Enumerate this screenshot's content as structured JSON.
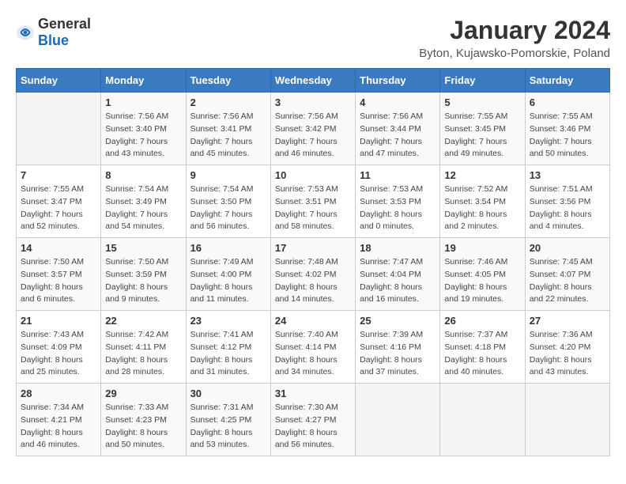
{
  "logo": {
    "general": "General",
    "blue": "Blue"
  },
  "title": "January 2024",
  "location": "Byton, Kujawsko-Pomorskie, Poland",
  "headers": [
    "Sunday",
    "Monday",
    "Tuesday",
    "Wednesday",
    "Thursday",
    "Friday",
    "Saturday"
  ],
  "weeks": [
    [
      {
        "day": "",
        "sunrise": "",
        "sunset": "",
        "daylight": ""
      },
      {
        "day": "1",
        "sunrise": "Sunrise: 7:56 AM",
        "sunset": "Sunset: 3:40 PM",
        "daylight": "Daylight: 7 hours and 43 minutes."
      },
      {
        "day": "2",
        "sunrise": "Sunrise: 7:56 AM",
        "sunset": "Sunset: 3:41 PM",
        "daylight": "Daylight: 7 hours and 45 minutes."
      },
      {
        "day": "3",
        "sunrise": "Sunrise: 7:56 AM",
        "sunset": "Sunset: 3:42 PM",
        "daylight": "Daylight: 7 hours and 46 minutes."
      },
      {
        "day": "4",
        "sunrise": "Sunrise: 7:56 AM",
        "sunset": "Sunset: 3:44 PM",
        "daylight": "Daylight: 7 hours and 47 minutes."
      },
      {
        "day": "5",
        "sunrise": "Sunrise: 7:55 AM",
        "sunset": "Sunset: 3:45 PM",
        "daylight": "Daylight: 7 hours and 49 minutes."
      },
      {
        "day": "6",
        "sunrise": "Sunrise: 7:55 AM",
        "sunset": "Sunset: 3:46 PM",
        "daylight": "Daylight: 7 hours and 50 minutes."
      }
    ],
    [
      {
        "day": "7",
        "sunrise": "Sunrise: 7:55 AM",
        "sunset": "Sunset: 3:47 PM",
        "daylight": "Daylight: 7 hours and 52 minutes."
      },
      {
        "day": "8",
        "sunrise": "Sunrise: 7:54 AM",
        "sunset": "Sunset: 3:49 PM",
        "daylight": "Daylight: 7 hours and 54 minutes."
      },
      {
        "day": "9",
        "sunrise": "Sunrise: 7:54 AM",
        "sunset": "Sunset: 3:50 PM",
        "daylight": "Daylight: 7 hours and 56 minutes."
      },
      {
        "day": "10",
        "sunrise": "Sunrise: 7:53 AM",
        "sunset": "Sunset: 3:51 PM",
        "daylight": "Daylight: 7 hours and 58 minutes."
      },
      {
        "day": "11",
        "sunrise": "Sunrise: 7:53 AM",
        "sunset": "Sunset: 3:53 PM",
        "daylight": "Daylight: 8 hours and 0 minutes."
      },
      {
        "day": "12",
        "sunrise": "Sunrise: 7:52 AM",
        "sunset": "Sunset: 3:54 PM",
        "daylight": "Daylight: 8 hours and 2 minutes."
      },
      {
        "day": "13",
        "sunrise": "Sunrise: 7:51 AM",
        "sunset": "Sunset: 3:56 PM",
        "daylight": "Daylight: 8 hours and 4 minutes."
      }
    ],
    [
      {
        "day": "14",
        "sunrise": "Sunrise: 7:50 AM",
        "sunset": "Sunset: 3:57 PM",
        "daylight": "Daylight: 8 hours and 6 minutes."
      },
      {
        "day": "15",
        "sunrise": "Sunrise: 7:50 AM",
        "sunset": "Sunset: 3:59 PM",
        "daylight": "Daylight: 8 hours and 9 minutes."
      },
      {
        "day": "16",
        "sunrise": "Sunrise: 7:49 AM",
        "sunset": "Sunset: 4:00 PM",
        "daylight": "Daylight: 8 hours and 11 minutes."
      },
      {
        "day": "17",
        "sunrise": "Sunrise: 7:48 AM",
        "sunset": "Sunset: 4:02 PM",
        "daylight": "Daylight: 8 hours and 14 minutes."
      },
      {
        "day": "18",
        "sunrise": "Sunrise: 7:47 AM",
        "sunset": "Sunset: 4:04 PM",
        "daylight": "Daylight: 8 hours and 16 minutes."
      },
      {
        "day": "19",
        "sunrise": "Sunrise: 7:46 AM",
        "sunset": "Sunset: 4:05 PM",
        "daylight": "Daylight: 8 hours and 19 minutes."
      },
      {
        "day": "20",
        "sunrise": "Sunrise: 7:45 AM",
        "sunset": "Sunset: 4:07 PM",
        "daylight": "Daylight: 8 hours and 22 minutes."
      }
    ],
    [
      {
        "day": "21",
        "sunrise": "Sunrise: 7:43 AM",
        "sunset": "Sunset: 4:09 PM",
        "daylight": "Daylight: 8 hours and 25 minutes."
      },
      {
        "day": "22",
        "sunrise": "Sunrise: 7:42 AM",
        "sunset": "Sunset: 4:11 PM",
        "daylight": "Daylight: 8 hours and 28 minutes."
      },
      {
        "day": "23",
        "sunrise": "Sunrise: 7:41 AM",
        "sunset": "Sunset: 4:12 PM",
        "daylight": "Daylight: 8 hours and 31 minutes."
      },
      {
        "day": "24",
        "sunrise": "Sunrise: 7:40 AM",
        "sunset": "Sunset: 4:14 PM",
        "daylight": "Daylight: 8 hours and 34 minutes."
      },
      {
        "day": "25",
        "sunrise": "Sunrise: 7:39 AM",
        "sunset": "Sunset: 4:16 PM",
        "daylight": "Daylight: 8 hours and 37 minutes."
      },
      {
        "day": "26",
        "sunrise": "Sunrise: 7:37 AM",
        "sunset": "Sunset: 4:18 PM",
        "daylight": "Daylight: 8 hours and 40 minutes."
      },
      {
        "day": "27",
        "sunrise": "Sunrise: 7:36 AM",
        "sunset": "Sunset: 4:20 PM",
        "daylight": "Daylight: 8 hours and 43 minutes."
      }
    ],
    [
      {
        "day": "28",
        "sunrise": "Sunrise: 7:34 AM",
        "sunset": "Sunset: 4:21 PM",
        "daylight": "Daylight: 8 hours and 46 minutes."
      },
      {
        "day": "29",
        "sunrise": "Sunrise: 7:33 AM",
        "sunset": "Sunset: 4:23 PM",
        "daylight": "Daylight: 8 hours and 50 minutes."
      },
      {
        "day": "30",
        "sunrise": "Sunrise: 7:31 AM",
        "sunset": "Sunset: 4:25 PM",
        "daylight": "Daylight: 8 hours and 53 minutes."
      },
      {
        "day": "31",
        "sunrise": "Sunrise: 7:30 AM",
        "sunset": "Sunset: 4:27 PM",
        "daylight": "Daylight: 8 hours and 56 minutes."
      },
      {
        "day": "",
        "sunrise": "",
        "sunset": "",
        "daylight": ""
      },
      {
        "day": "",
        "sunrise": "",
        "sunset": "",
        "daylight": ""
      },
      {
        "day": "",
        "sunrise": "",
        "sunset": "",
        "daylight": ""
      }
    ]
  ]
}
